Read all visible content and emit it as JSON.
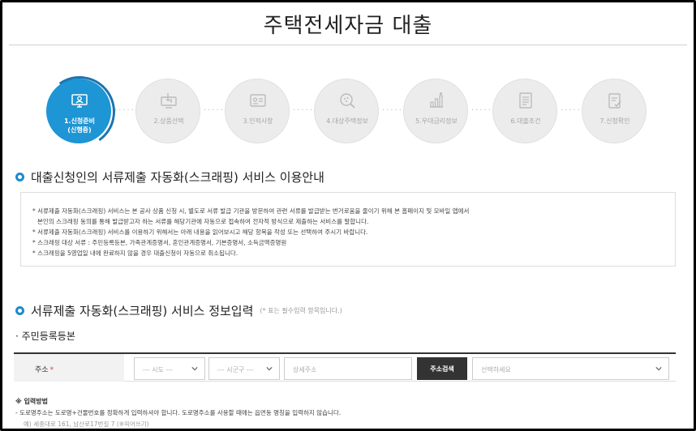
{
  "page": {
    "title": "주택전세자금 대출"
  },
  "steps": [
    {
      "label_line1": "1.신청준비",
      "label_line2": "(신행중)",
      "icon": "monitor-person-icon",
      "active": true
    },
    {
      "label_line1": "2.상품선택",
      "icon": "hand-cursor-icon",
      "active": false
    },
    {
      "label_line1": "3.인적사항",
      "icon": "id-card-icon",
      "active": false
    },
    {
      "label_line1": "4.대상주택정보",
      "icon": "house-search-icon",
      "active": false
    },
    {
      "label_line1": "5.우대금리정보",
      "icon": "bar-chart-icon",
      "active": false
    },
    {
      "label_line1": "6.대출조건",
      "icon": "document-icon",
      "active": false
    },
    {
      "label_line1": "7.신청확인",
      "icon": "checklist-icon",
      "active": false
    }
  ],
  "section1": {
    "title": "대출신청인의 서류제출 자동화(스크래핑) 서비스 이용안내",
    "lines": [
      "* 서류제출 자동화(스크래핑) 서비스는 본 공사 상품 신청 시, 별도로 서류 발급 기관을 방문하여 관련 서류를 발급받는 번거로움을 줄이기 위해 본 홈페이지 및 모바일 앱에서",
      "본인의 스크래핑 동의를 통해 발급받고자 하는 서류를 해당기관에 자동으로 접속하여 전자적 방식으로 제출하는 서비스를 말합니다.",
      "* 서류제출 자동화(스크래핑) 서비스를 이용하기 위해서는 아래 내용을 읽어보시고 해당 항목을 작성 또는 선택하여 주시기 바랍니다.",
      "* 스크래핑 대상 서류 : 주민등록등본, 가족관계증명서, 혼인관계증명서, 기본증명서, 소득금액증명원",
      "* 스크래핑을 5영업일 내에 완료하지 않을 경우 대출신청이 자동으로 취소됩니다."
    ]
  },
  "section2": {
    "title": "서류제출 자동화(스크래핑) 서비스 정보입력",
    "note": "(* 표는 필수입력 항목입니다.)",
    "subheading": "· 주민등록등본"
  },
  "address_form": {
    "label": "주소",
    "required_mark": "*",
    "sido_placeholder": "--- 시도 ---",
    "sigungu_placeholder": "--- 시군구 ---",
    "detail_placeholder": "상세주소",
    "search_button": "주소검색",
    "result_placeholder": "선택하세요"
  },
  "guide": {
    "title": "※ 입력방법",
    "line1": "- 도로명주소는 도로명+건물번호를 정확하게 입력하셔야 합니다. 도로명주소를 사용할 때에는 읍면동 명칭을 입력하지 않습니다.",
    "example": "예) 세종대로 161, 남산로17번길 7 (※띄어쓰기)"
  },
  "colors": {
    "accent": "#1e95d4",
    "bullet": "#1e88d0",
    "button_dark": "#333333"
  }
}
